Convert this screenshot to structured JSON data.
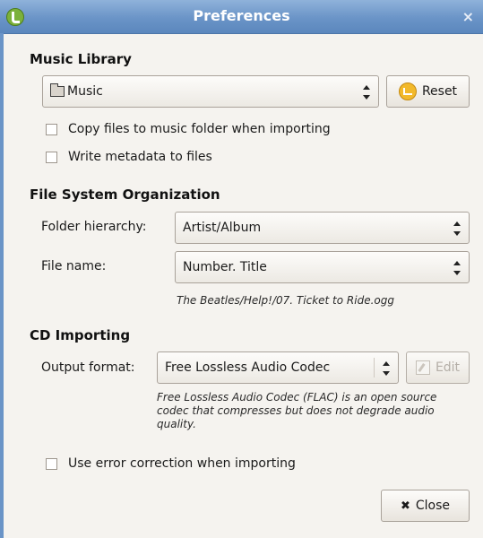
{
  "window": {
    "title": "Preferences",
    "close_glyph": "×"
  },
  "music_library": {
    "heading": "Music Library",
    "folder_value": "Music",
    "reset_label": "Reset",
    "copy_files_label": "Copy files to music folder when importing",
    "write_metadata_label": "Write metadata to files"
  },
  "file_system": {
    "heading": "File System Organization",
    "folder_hierarchy_label": "Folder hierarchy:",
    "folder_hierarchy_value": "Artist/Album",
    "file_name_label": "File name:",
    "file_name_value": "Number. Title",
    "example_path": "The Beatles/Help!/07. Ticket to Ride.ogg"
  },
  "cd_importing": {
    "heading": "CD Importing",
    "output_format_label": "Output format:",
    "output_format_value": "Free Lossless Audio Codec",
    "edit_label": "Edit",
    "codec_description": "Free Lossless Audio Codec (FLAC) is an open source codec that compresses but does not degrade audio quality.",
    "error_correction_label": "Use error correction when importing"
  },
  "footer": {
    "close_label": "Close",
    "close_glyph": "✖"
  }
}
